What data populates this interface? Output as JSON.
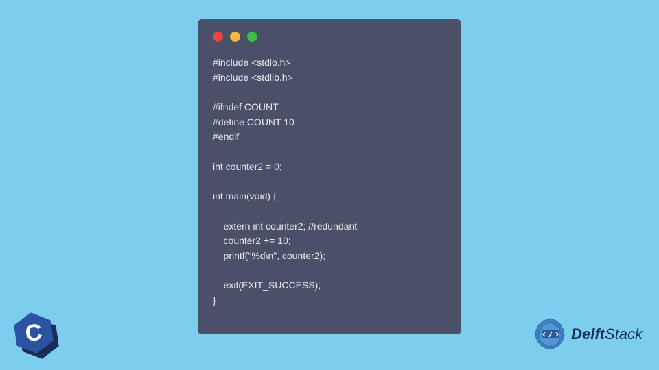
{
  "code_lines": [
    "#include <stdio.h>",
    "#include <stdlib.h>",
    "",
    "#ifndef COUNT",
    "#define COUNT 10",
    "#endif",
    "",
    "int counter2 = 0;",
    "",
    "int main(void) {",
    "",
    "    extern int counter2; //redundant",
    "    counter2 += 10;",
    "    printf(\"%d\\n\", counter2);",
    "",
    "    exit(EXIT_SUCCESS);",
    "}"
  ],
  "c_logo_letter": "C",
  "brand_name_1": "Delft",
  "brand_name_2": "Stack",
  "colors": {
    "background": "#7dcdef",
    "window_bg": "#4a5068",
    "dot_red": "#ec4444",
    "dot_yellow": "#f4b83e",
    "dot_green": "#3bbd47",
    "code_text": "#e8e8ea",
    "c_logo": "#2a54a3",
    "brand_text": "#1a2d5a"
  }
}
